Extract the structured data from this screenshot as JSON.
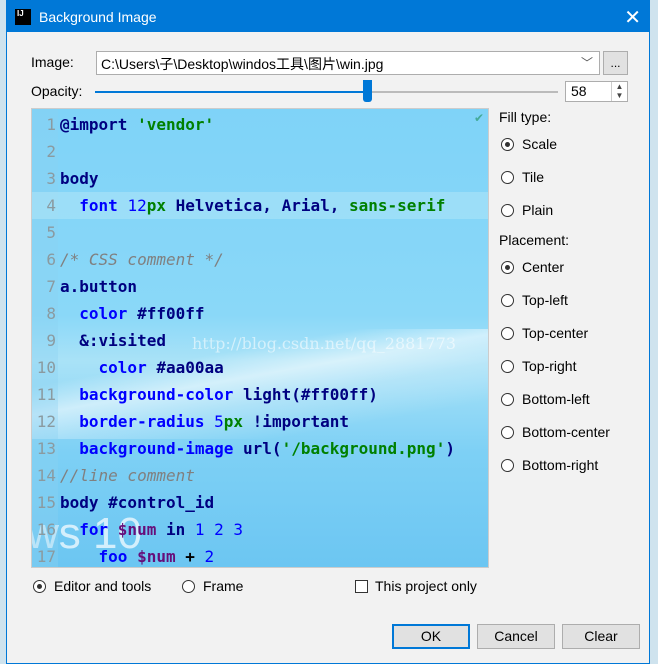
{
  "window": {
    "title": "Background Image",
    "app_icon": "IJ"
  },
  "image": {
    "label": "Image:",
    "value": "C:\\Users\\子\\Desktop\\windos工具\\图片\\win.jpg",
    "browse_label": "..."
  },
  "opacity": {
    "label": "Opacity:",
    "value": "58",
    "percent": 58
  },
  "preview": {
    "watermark": "http://blog.csdn.net/qq_2881773",
    "bg_text": "ws 10",
    "lines": [
      {
        "n": "1",
        "t": [
          [
            "@import ",
            "kw"
          ],
          [
            "'vendor'",
            "str"
          ]
        ]
      },
      {
        "n": "2",
        "t": []
      },
      {
        "n": "3",
        "t": [
          [
            "body",
            "kw"
          ]
        ]
      },
      {
        "n": "4",
        "hl": true,
        "t": [
          [
            "  font ",
            "prop"
          ],
          [
            "12",
            "num"
          ],
          [
            "px ",
            "str"
          ],
          [
            "Helvetica, Arial, ",
            "kw"
          ],
          [
            "sans-serif",
            "str"
          ]
        ]
      },
      {
        "n": "5",
        "t": []
      },
      {
        "n": "6",
        "t": [
          [
            "/* CSS comment */",
            "cmt"
          ]
        ]
      },
      {
        "n": "7",
        "t": [
          [
            "a.button",
            "kw"
          ]
        ]
      },
      {
        "n": "8",
        "t": [
          [
            "  color ",
            "prop"
          ],
          [
            "#ff00ff",
            "kw"
          ]
        ]
      },
      {
        "n": "9",
        "t": [
          [
            "  &:visited",
            "kw"
          ]
        ]
      },
      {
        "n": "10",
        "t": [
          [
            "    color ",
            "prop"
          ],
          [
            "#aa00aa",
            "kw"
          ]
        ]
      },
      {
        "n": "11",
        "t": [
          [
            "  background-color ",
            "prop"
          ],
          [
            "light(#ff00ff)",
            "kw"
          ]
        ]
      },
      {
        "n": "12",
        "t": [
          [
            "  border-radius ",
            "prop"
          ],
          [
            "5",
            "num"
          ],
          [
            "px ",
            "str"
          ],
          [
            "!important",
            "kw"
          ]
        ]
      },
      {
        "n": "13",
        "t": [
          [
            "  background-image ",
            "prop"
          ],
          [
            "url(",
            "kw"
          ],
          [
            "'/background.png'",
            "str"
          ],
          [
            ")",
            "kw"
          ]
        ]
      },
      {
        "n": "14",
        "t": [
          [
            "//line comment",
            "cmt"
          ]
        ]
      },
      {
        "n": "15",
        "t": [
          [
            "body #control_id",
            "kw"
          ]
        ]
      },
      {
        "n": "16",
        "t": [
          [
            "  for ",
            "prop"
          ],
          [
            "$num ",
            "var"
          ],
          [
            "in ",
            "kw"
          ],
          [
            "1 2 3",
            "num"
          ]
        ]
      },
      {
        "n": "17",
        "t": [
          [
            "    foo ",
            "prop"
          ],
          [
            "$num ",
            "var"
          ],
          [
            "+ ",
            "pl"
          ],
          [
            "2",
            "num"
          ]
        ]
      }
    ]
  },
  "fill_type": {
    "label": "Fill type:",
    "options": [
      "Scale",
      "Tile",
      "Plain"
    ],
    "selected": "Scale"
  },
  "placement": {
    "label": "Placement:",
    "options": [
      "Center",
      "Top-left",
      "Top-center",
      "Top-right",
      "Bottom-left",
      "Bottom-center",
      "Bottom-right"
    ],
    "selected": "Center"
  },
  "target": {
    "options": [
      "Editor and tools",
      "Frame"
    ],
    "selected": "Editor and tools"
  },
  "this_project_only": {
    "label": "This project only",
    "checked": false
  },
  "buttons": {
    "ok": "OK",
    "cancel": "Cancel",
    "clear": "Clear"
  },
  "colors": {
    "titlebar": "#0078d7",
    "accent": "#0078d7"
  }
}
